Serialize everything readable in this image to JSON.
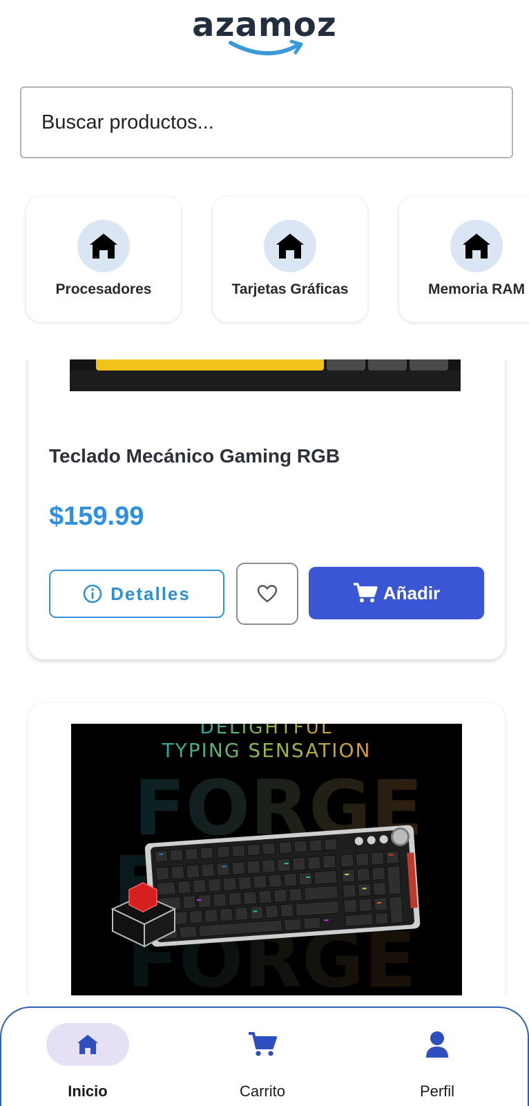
{
  "header": {
    "logo_text": "azamoz"
  },
  "search": {
    "placeholder": "Buscar productos..."
  },
  "categories": [
    {
      "label": "Procesadores",
      "icon": "home-icon"
    },
    {
      "label": "Tarjetas Gráficas",
      "icon": "home-icon"
    },
    {
      "label": "Memoria RAM",
      "icon": "home-icon"
    }
  ],
  "products": [
    {
      "title": "Teclado Mecánico Gaming RGB",
      "price": "$159.99",
      "details_label": "Detalles",
      "add_label": "Añadir"
    },
    {
      "image_text": {
        "line1": "DELIGHTFUL",
        "line2": "TYPING SENSATION",
        "watermark": "FORGE"
      }
    }
  ],
  "bottom_nav": {
    "items": [
      {
        "label": "Inicio",
        "icon": "home-icon",
        "active": true
      },
      {
        "label": "Carrito",
        "icon": "cart-icon",
        "active": false
      },
      {
        "label": "Perfil",
        "icon": "user-icon",
        "active": false
      }
    ]
  },
  "colors": {
    "accent_blue": "#3a56d4",
    "price_blue": "#2d8fe0",
    "logo_dark": "#232f3e",
    "logo_smile": "#3b9ad9",
    "nav_active_bg": "#e6e0f4"
  }
}
